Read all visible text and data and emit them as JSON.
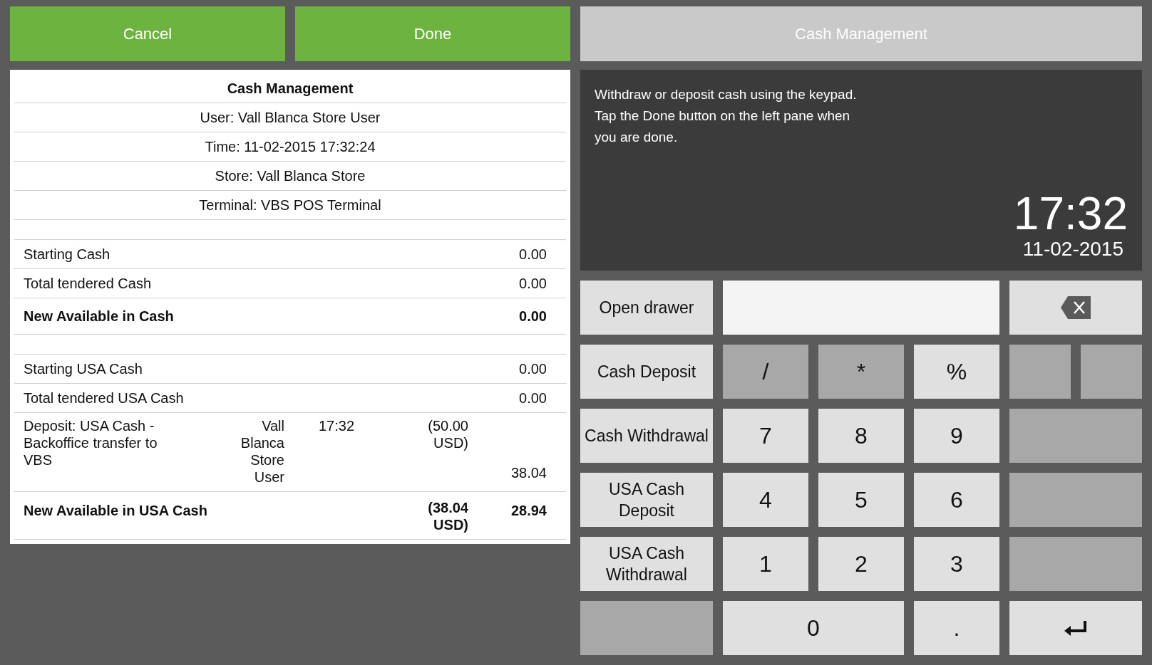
{
  "actions": [
    {
      "label": "Cancel"
    },
    {
      "label": "Done"
    }
  ],
  "header": {
    "title": "Cash Management"
  },
  "receipt": {
    "rows": [
      {
        "kind": "title",
        "text": "Cash Management"
      },
      {
        "kind": "info",
        "text": "User: Vall Blanca Store User"
      },
      {
        "kind": "info",
        "text": "Time: 11-02-2015 17:32:24"
      },
      {
        "kind": "info",
        "text": "Store: Vall Blanca Store"
      },
      {
        "kind": "info",
        "text": "Terminal: VBS POS Terminal"
      },
      {
        "kind": "spacer"
      },
      {
        "kind": "line",
        "label": "Starting Cash",
        "value": "0.00"
      },
      {
        "kind": "line",
        "label": "Total tendered Cash",
        "value": "0.00"
      },
      {
        "kind": "total",
        "label": "New Available in Cash",
        "value": "0.00"
      },
      {
        "kind": "spacer"
      },
      {
        "kind": "line",
        "label": "Starting USA Cash",
        "value": "0.00"
      },
      {
        "kind": "line",
        "label": "Total tendered USA Cash",
        "value": "0.00"
      },
      {
        "kind": "detail",
        "description": "Deposit: USA Cash - Backoffice transfer to VBS",
        "user": "Vall Blanca Store User",
        "time": "17:32",
        "amount": "(50.00 USD)",
        "value": "38.04"
      },
      {
        "kind": "subtotal",
        "label": "New Available in USA Cash",
        "amount": "(38.04 USD)",
        "value": "28.94"
      }
    ]
  },
  "info": {
    "message": "Withdraw or deposit cash using the keypad. Tap the Done button on the left pane when you are done.",
    "time": "17:32",
    "date": "11-02-2015"
  },
  "keypad": {
    "functions": [
      {
        "kind": "function",
        "label": "Open drawer"
      },
      {
        "kind": "function",
        "label": "Cash Deposit"
      },
      {
        "kind": "function",
        "label": "Cash Withdrawal"
      },
      {
        "kind": "function",
        "label": "USA Cash Deposit"
      },
      {
        "kind": "function",
        "label": "USA Cash Withdrawal"
      },
      {
        "kind": "blank"
      }
    ],
    "top": [
      {
        "kind": "display"
      },
      {
        "kind": "backspace"
      }
    ],
    "rows": [
      [
        {
          "kind": "key",
          "label": "/",
          "disabled": true
        },
        {
          "kind": "key",
          "label": "*",
          "disabled": true
        },
        {
          "kind": "key",
          "label": "%",
          "disabled": false
        },
        {
          "kind": "blank"
        },
        {
          "kind": "blank"
        }
      ],
      [
        {
          "kind": "key",
          "label": "7",
          "disabled": false
        },
        {
          "kind": "key",
          "label": "8",
          "disabled": false
        },
        {
          "kind": "key",
          "label": "9",
          "disabled": false
        },
        {
          "kind": "blank"
        }
      ],
      [
        {
          "kind": "key",
          "label": "4",
          "disabled": false
        },
        {
          "kind": "key",
          "label": "5",
          "disabled": false
        },
        {
          "kind": "key",
          "label": "6",
          "disabled": false
        },
        {
          "kind": "blank"
        }
      ],
      [
        {
          "kind": "key",
          "label": "1",
          "disabled": false
        },
        {
          "kind": "key",
          "label": "2",
          "disabled": false
        },
        {
          "kind": "key",
          "label": "3",
          "disabled": false
        },
        {
          "kind": "blank"
        }
      ]
    ],
    "bottom": [
      {
        "kind": "key",
        "label": "0",
        "disabled": false
      },
      {
        "kind": "key",
        "label": ".",
        "disabled": false
      },
      {
        "kind": "enter"
      }
    ]
  }
}
